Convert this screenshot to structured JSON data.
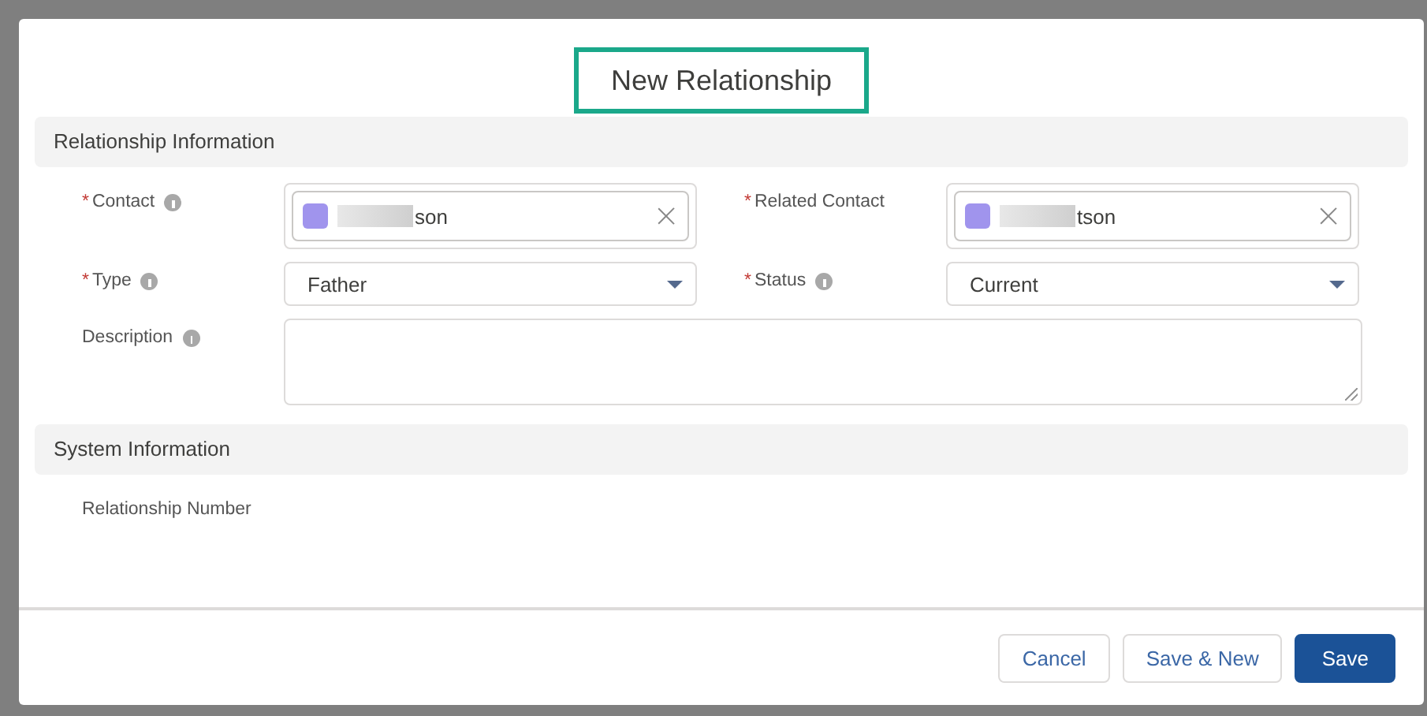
{
  "dialog": {
    "title": "New Relationship",
    "title_highlighted": true
  },
  "sections": [
    {
      "title": "Relationship Information",
      "fields": [
        {
          "kind": "lookup",
          "label": "Contact",
          "required_mark": "*",
          "info": true,
          "redacted": true,
          "value": "son"
        },
        {
          "kind": "lookup",
          "label": "Related Contact",
          "required_mark": "*",
          "info": false,
          "redacted": true,
          "value": "tson"
        },
        {
          "kind": "select",
          "label": "Type",
          "required_mark": "*",
          "info": true,
          "value": "Father"
        },
        {
          "kind": "select",
          "label": "Status",
          "required_mark": "*",
          "info": true,
          "value": "Current"
        },
        {
          "kind": "textarea",
          "label": "Description",
          "info": true
        }
      ]
    },
    {
      "title": "System Information",
      "fields": [
        {
          "kind": "readonly",
          "label": "Relationship Number"
        }
      ]
    }
  ],
  "buttons": [
    {
      "label": "Cancel",
      "primary": false
    },
    {
      "label": "Save & New",
      "primary": false
    },
    {
      "label": "Save",
      "primary": true
    }
  ]
}
